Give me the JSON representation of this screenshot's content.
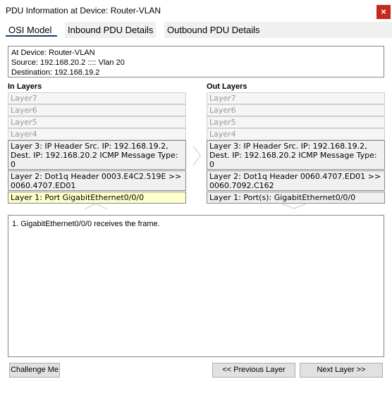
{
  "window": {
    "title": "PDU Information at Device: Router-VLAN",
    "close_glyph": "×"
  },
  "tabs": [
    {
      "label": "OSI Model",
      "active": true
    },
    {
      "label": "Inbound PDU Details",
      "active": false
    },
    {
      "label": "Outbound PDU Details",
      "active": false
    }
  ],
  "info": {
    "line1": "At Device: Router-VLAN",
    "line2": "Source: 192.168.20.2 :::: Vlan 20",
    "line3": "Destination: 192.168.19.2"
  },
  "in_layers": {
    "heading": "In Layers",
    "layer7": "Layer7",
    "layer6": "Layer6",
    "layer5": "Layer5",
    "layer4": "Layer4",
    "layer3": "Layer 3: IP Header Src. IP: 192.168.19.2, Dest. IP: 192.168.20.2 ICMP Message Type: 0",
    "layer2": "Layer 2: Dot1q Header 0003.E4C2.519E >> 0060.4707.ED01",
    "layer1": "Layer 1: Port GigabitEthernet0/0/0"
  },
  "out_layers": {
    "heading": "Out Layers",
    "layer7": "Layer7",
    "layer6": "Layer6",
    "layer5": "Layer5",
    "layer4": "Layer4",
    "layer3": "Layer 3: IP Header Src. IP: 192.168.19.2, Dest. IP: 192.168.20.2 ICMP Message Type: 0",
    "layer2": "Layer 2: Dot1q Header 0060.4707.ED01 >> 0060.7092.C162",
    "layer1": "Layer 1: Port(s): GigabitEthernet0/0/0"
  },
  "details": {
    "line1": "1. GigabitEthernet0/0/0 receives the frame."
  },
  "buttons": {
    "challenge": "Challenge Me",
    "previous": "<< Previous Layer",
    "next": "Next Layer >>"
  },
  "colors": {
    "highlight": "#ffffcc",
    "close": "#c42b1c",
    "tab_underline": "#1a3a6e"
  }
}
